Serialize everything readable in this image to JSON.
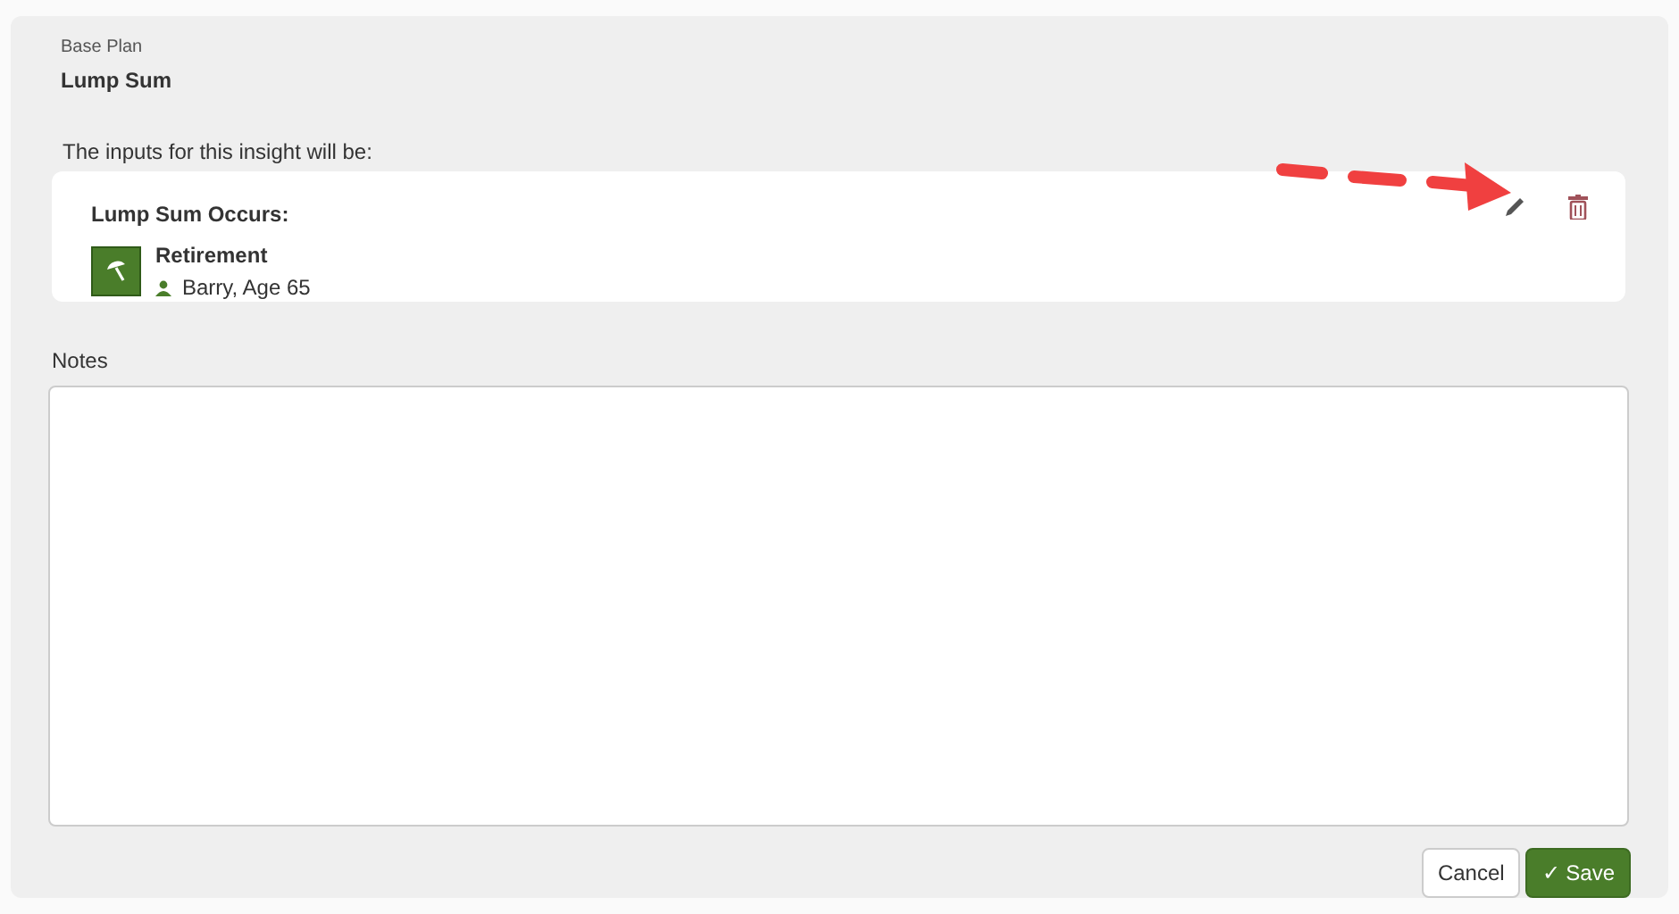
{
  "header": {
    "plan": "Base Plan",
    "title": "Lump Sum"
  },
  "inputs_label": "The inputs for this insight will be:",
  "input_card": {
    "heading": "Lump Sum Occurs:",
    "event": "Retirement",
    "person": "Barry, Age 65"
  },
  "notes": {
    "label": "Notes"
  },
  "buttons": [
    {
      "label": "Cancel",
      "kind": "secondary"
    },
    {
      "label": "✓ Save",
      "kind": "primary"
    }
  ]
}
